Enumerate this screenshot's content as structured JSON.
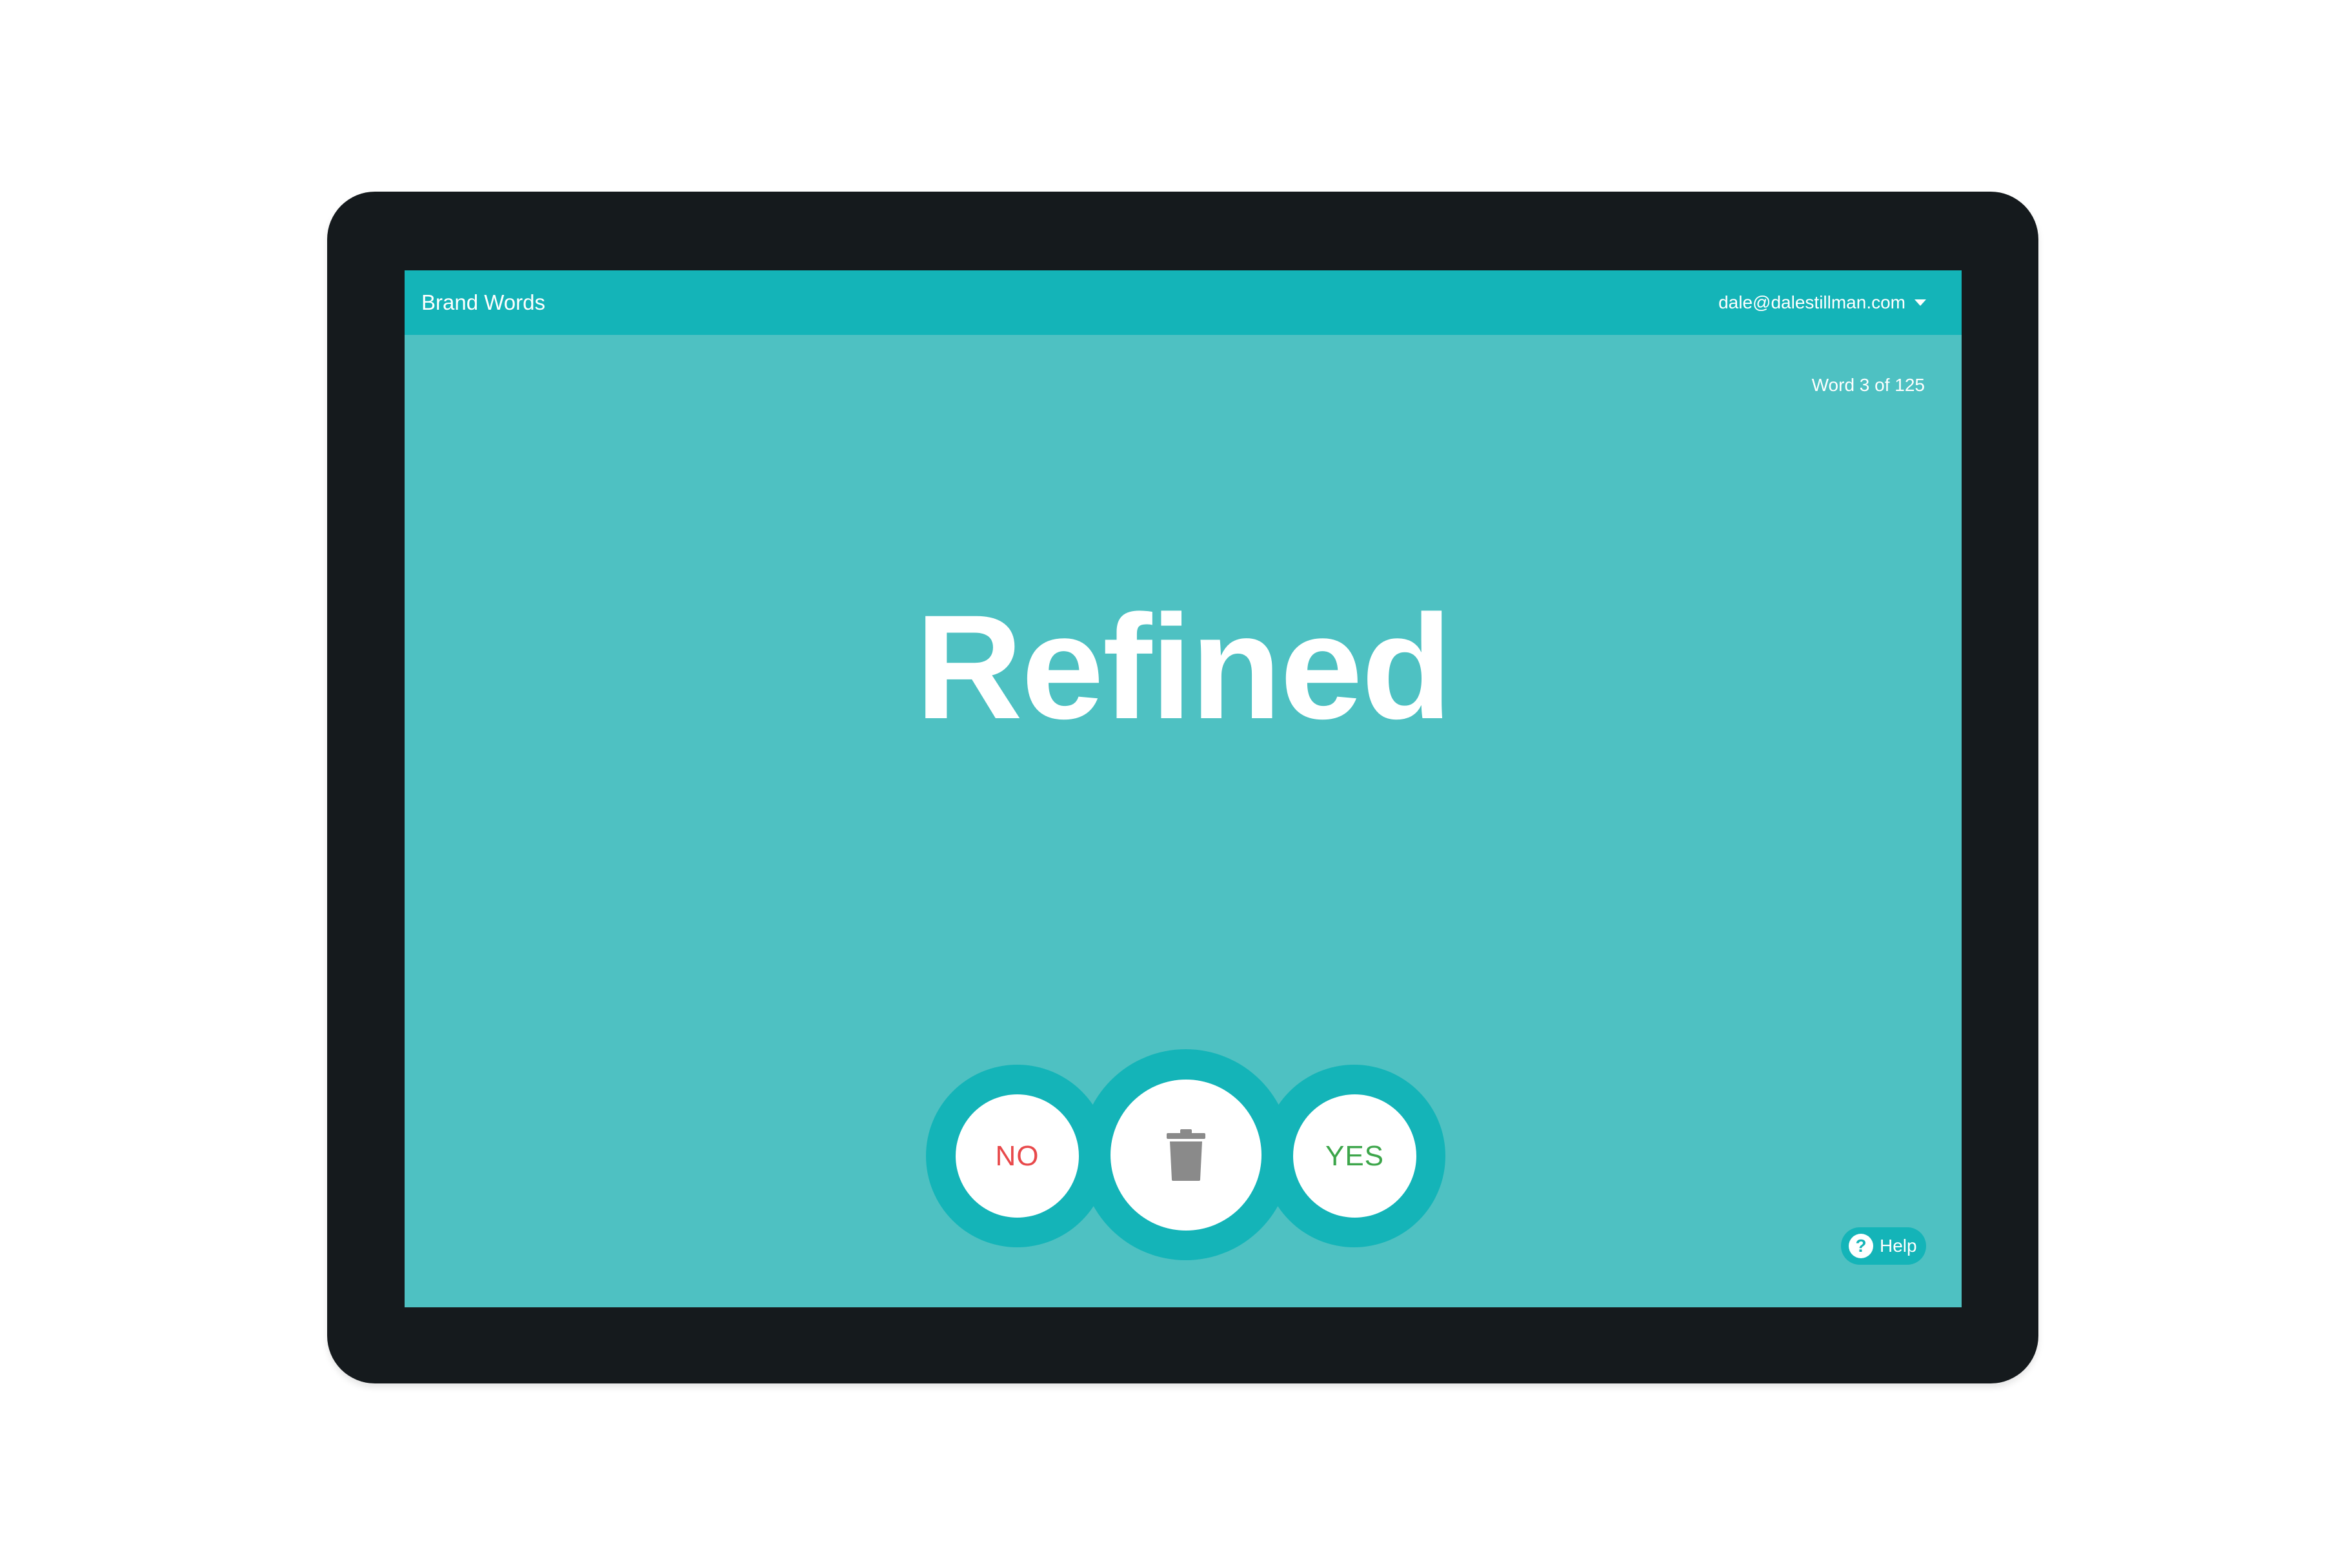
{
  "header": {
    "title": "Brand Words",
    "user_email": "dale@dalestillman.com",
    "user_menu_icon": "chevron-down-icon"
  },
  "progress": {
    "text": "Word 3 of 125",
    "current": 3,
    "total": 125
  },
  "card": {
    "word": "Refined"
  },
  "actions": {
    "no_label": "NO",
    "delete_icon": "trash-icon",
    "yes_label": "YES"
  },
  "help": {
    "label": "Help",
    "icon": "question-icon",
    "icon_glyph": "?"
  },
  "colors": {
    "background": "#4ec1c2",
    "accent": "#14b4b8",
    "no": "#e8494b",
    "yes": "#3da64b",
    "device_bezel": "#151a1d",
    "trash": "#8a8a8a"
  }
}
